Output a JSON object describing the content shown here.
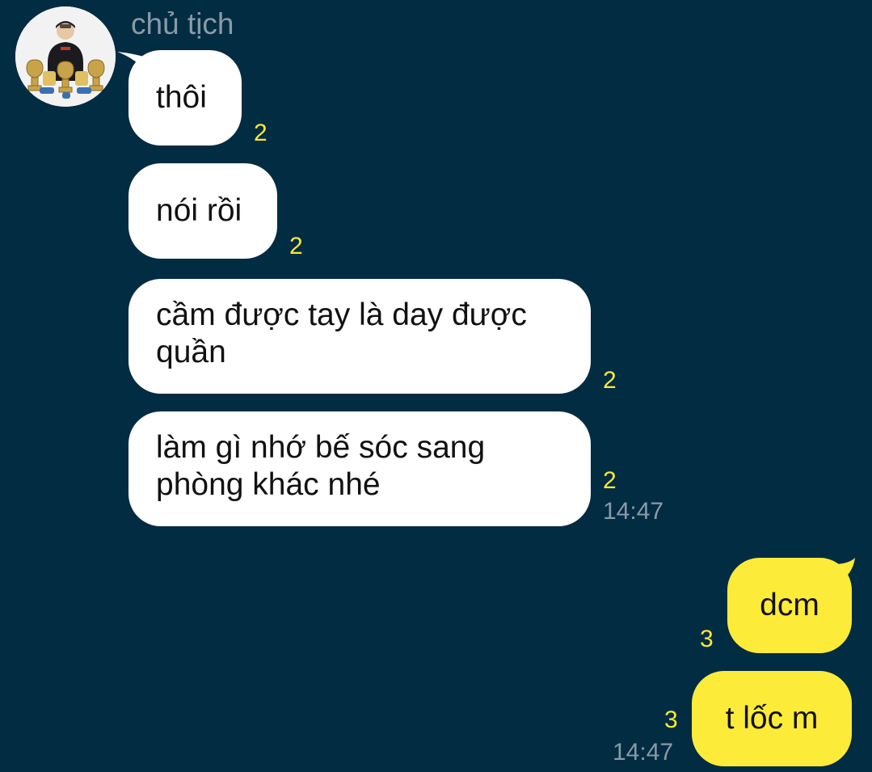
{
  "conversation": {
    "sender_name": "chủ tịch",
    "incoming": [
      {
        "text": "thôi",
        "unread": "2"
      },
      {
        "text": "nói rồi",
        "unread": "2"
      },
      {
        "text_line1": "cầm được tay là day được",
        "text_line2": "quần",
        "unread": "2"
      },
      {
        "text_line1": "làm gì nhớ bế sóc sang",
        "text_line2": "phòng khác nhé",
        "unread": "2",
        "time": "14:47"
      }
    ],
    "outgoing": [
      {
        "text": "dcm",
        "unread": "3"
      },
      {
        "text": "t lốc m",
        "unread": "3",
        "time": "14:47"
      }
    ]
  },
  "colors": {
    "background": "#022c42",
    "incoming_bubble": "#ffffff",
    "outgoing_bubble": "#fdeb3a",
    "unread_count": "#f8e936",
    "meta_text": "#8a9aa6"
  },
  "icons": {
    "avatar": "profile-photo"
  }
}
